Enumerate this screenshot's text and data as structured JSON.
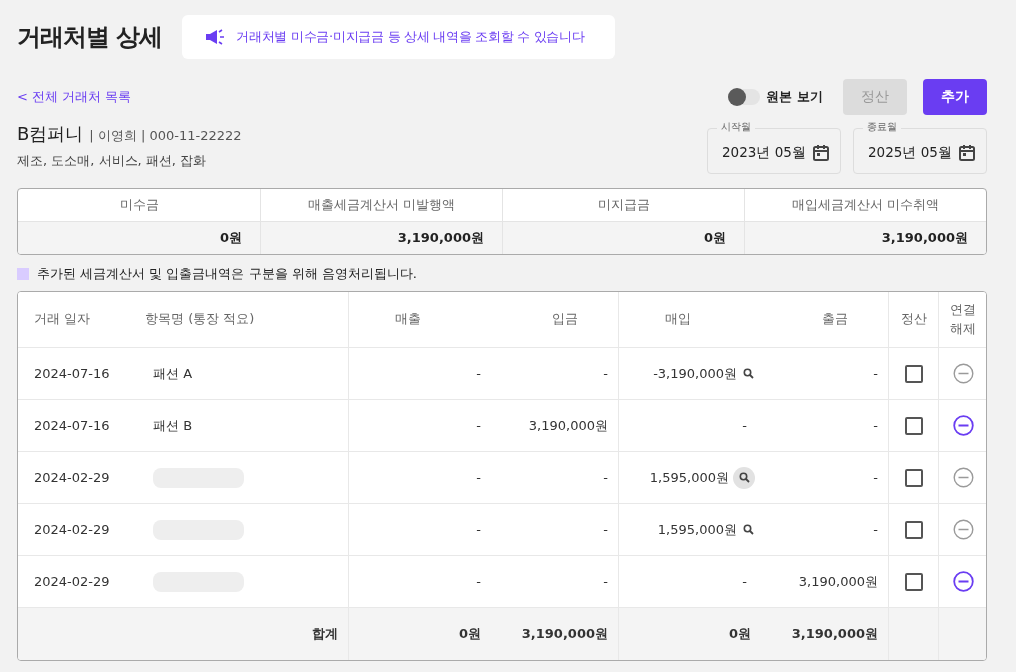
{
  "page_title": "거래처별 상세",
  "notice": "거래처별 미수금·미지급금 등 상세 내역을 조회할 수 있습니다",
  "back_link": "< 전체 거래처 목록",
  "original_toggle": {
    "label": "원본 보기",
    "on": false
  },
  "buttons": [
    {
      "label": "정산",
      "disabled": true
    },
    {
      "label": "추가",
      "disabled": false
    }
  ],
  "company": {
    "name": "B컴퍼니",
    "details": "| 이영희 | 000-11-22222",
    "categories": "제조, 도소매, 서비스, 패션, 잡화"
  },
  "date_range": [
    {
      "label": "시작월",
      "value": "2023년 05월"
    },
    {
      "label": "종료월",
      "value": "2025년 05월"
    }
  ],
  "summary": [
    {
      "label": "미수금",
      "value": "0원"
    },
    {
      "label": "매출세금계산서 미발행액",
      "value": "3,190,000원"
    },
    {
      "label": "미지급금",
      "value": "0원"
    },
    {
      "label": "매입세금계산서 미수취액",
      "value": "3,190,000원"
    }
  ],
  "legend": {
    "color": "#d9ccff",
    "text": "추가된 세금계산서 및 입출금내역은 구분을 위해 음영처리됩니다."
  },
  "table": {
    "columns": [
      "거래 일자",
      "항목명 (통장 적요)",
      "매출",
      "입금",
      "매입",
      "출금",
      "정산",
      "연결\n해제"
    ],
    "rows": [
      {
        "date": "2024-07-16",
        "masked": false,
        "name": "패션 A",
        "sales": "-",
        "deposit": "-",
        "purchase": "-3,190,000원",
        "search": {
          "highlighted": false
        },
        "withdrawal": "-",
        "checked": false,
        "unlink_active": false
      },
      {
        "date": "2024-07-16",
        "masked": false,
        "name": "패션 B",
        "sales": "-",
        "deposit": "3,190,000원",
        "purchase": "-",
        "withdrawal": "-",
        "checked": false,
        "unlink_active": true
      },
      {
        "date": "2024-02-29",
        "masked": true,
        "sales": "-",
        "deposit": "-",
        "purchase": "1,595,000원",
        "search": {
          "highlighted": true
        },
        "withdrawal": "-",
        "checked": false,
        "unlink_active": false
      },
      {
        "date": "2024-02-29",
        "masked": true,
        "sales": "-",
        "deposit": "-",
        "purchase": "1,595,000원",
        "search": {
          "highlighted": false
        },
        "withdrawal": "-",
        "checked": false,
        "unlink_active": false
      },
      {
        "date": "2024-02-29",
        "masked": true,
        "sales": "-",
        "deposit": "-",
        "purchase": "-",
        "withdrawal": "3,190,000원",
        "checked": false,
        "unlink_active": true
      }
    ],
    "total": {
      "label": "합계",
      "sales": "0원",
      "deposit": "3,190,000원",
      "purchase": "0원",
      "withdrawal": "3,190,000원"
    }
  }
}
